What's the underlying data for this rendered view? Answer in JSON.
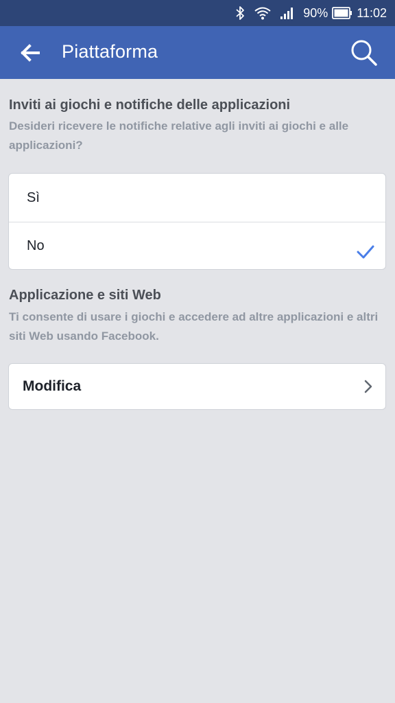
{
  "status_bar": {
    "battery_percent": "90%",
    "time": "11:02",
    "icons": [
      "bluetooth-icon",
      "wifi-icon",
      "signal-icon",
      "battery-icon"
    ]
  },
  "app_bar": {
    "title": "Piattaforma",
    "back_icon": "arrow-left-icon",
    "search_icon": "search-icon",
    "background_color": "#4064b4"
  },
  "notifications_section": {
    "title": "Inviti ai giochi e notifiche delle applicazioni",
    "description": "Desideri ricevere le notifiche relative agli inviti ai giochi e alle applicazioni?",
    "options": [
      {
        "label": "Sì",
        "selected": false
      },
      {
        "label": "No",
        "selected": true
      }
    ],
    "check_color": "#4a7ee8"
  },
  "apps_section": {
    "title": "Applicazione e siti Web",
    "description": "Ti consente di usare i giochi e accedere ad altre applicazioni e altri siti Web usando Facebook.",
    "edit_label": "Modifica"
  }
}
